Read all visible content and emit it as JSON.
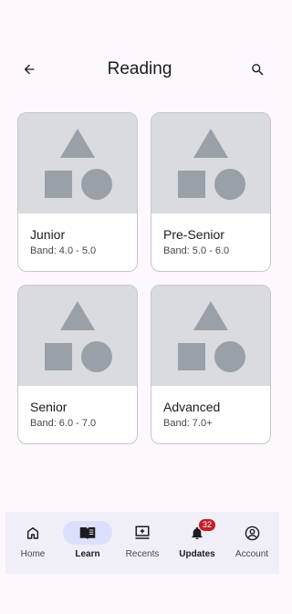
{
  "header": {
    "title": "Reading",
    "back_icon": "arrow-back-icon",
    "search_icon": "search-icon"
  },
  "cards": [
    {
      "title": "Junior",
      "band": "Band: 4.0 - 5.0",
      "image_icon": "shapes-placeholder-icon"
    },
    {
      "title": "Pre-Senior",
      "band": "Band: 5.0 - 6.0",
      "image_icon": "shapes-placeholder-icon"
    },
    {
      "title": "Senior",
      "band": "Band: 6.0 - 7.0",
      "image_icon": "shapes-placeholder-icon"
    },
    {
      "title": "Advanced",
      "band": "Band: 7.0+",
      "image_icon": "shapes-placeholder-icon"
    }
  ],
  "nav": {
    "items": [
      {
        "label": "Home",
        "icon": "home-icon"
      },
      {
        "label": "Learn",
        "icon": "book-icon",
        "active": true
      },
      {
        "label": "Recents",
        "icon": "recents-icon"
      },
      {
        "label": "Updates",
        "icon": "bell-icon",
        "badge": "32"
      },
      {
        "label": "Account",
        "icon": "account-icon"
      }
    ]
  },
  "colors": {
    "background": "#fdf8fd",
    "placeholder": "#d9dbde",
    "shape": "#9aa0a8",
    "nav_background": "#f0eff8",
    "active_indicator": "#dcdffa",
    "badge": "#c41e27"
  }
}
